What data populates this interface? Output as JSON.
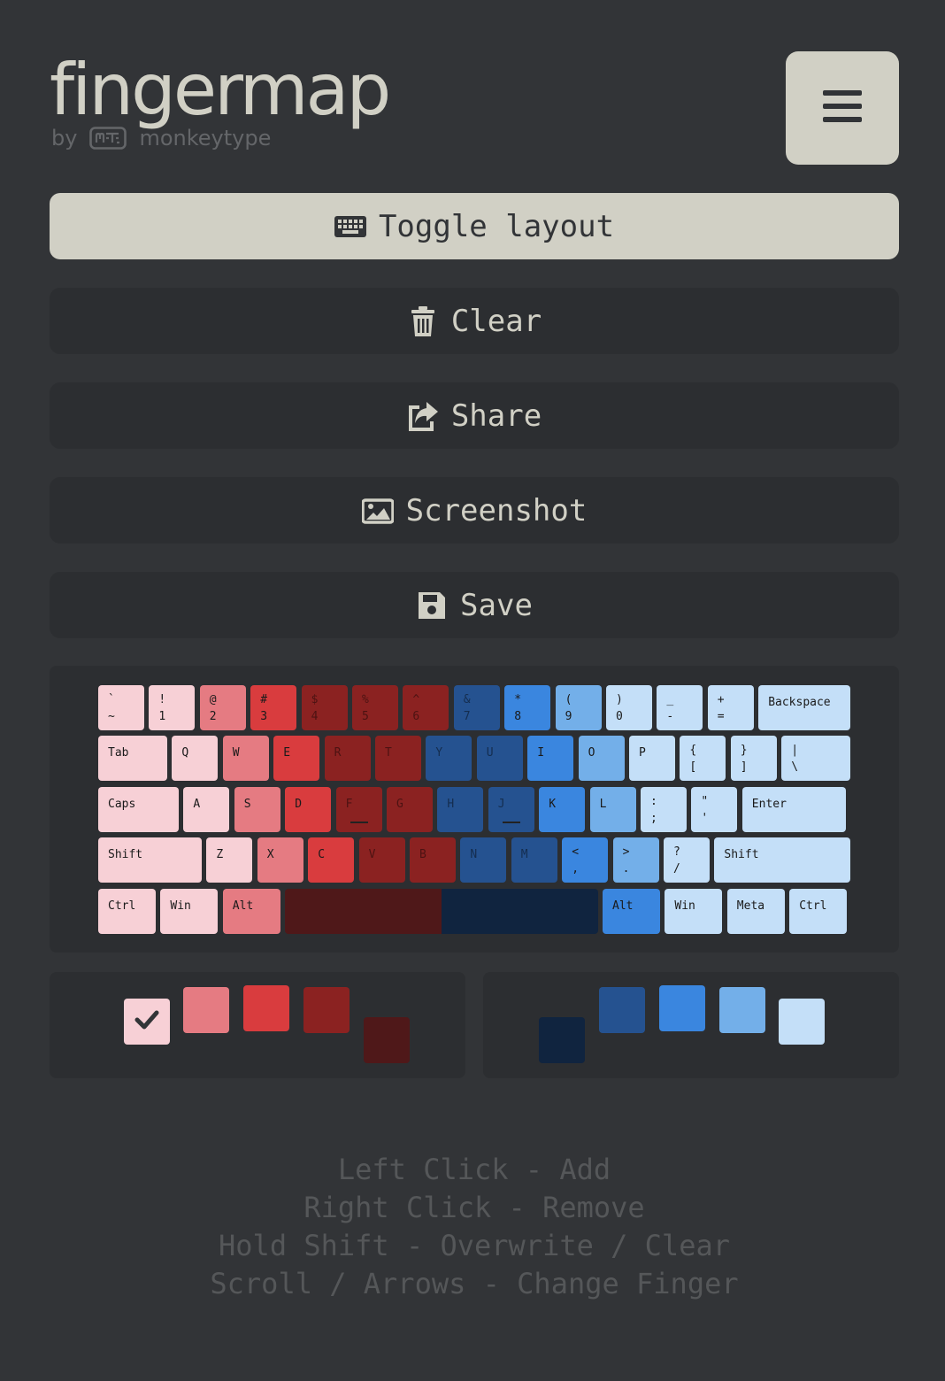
{
  "header": {
    "title": "fingermap",
    "by_label": "by",
    "brand_icon": "monkeytype-logo-icon",
    "brand_name": "monkeytype",
    "menu_icon": "hamburger-menu-icon"
  },
  "actions": [
    {
      "label": "Toggle layout",
      "icon": "keyboard-icon",
      "primary": true
    },
    {
      "label": "Clear",
      "icon": "trash-icon",
      "primary": false
    },
    {
      "label": "Share",
      "icon": "share-icon",
      "primary": false
    },
    {
      "label": "Screenshot",
      "icon": "image-icon",
      "primary": false
    },
    {
      "label": "Save",
      "icon": "floppy-disk-icon",
      "primary": false
    }
  ],
  "colors": {
    "background": "#323437",
    "panel": "#2c2e31",
    "text": "#d1d0c5",
    "muted": "#555759",
    "left_fingers": [
      "#f7d0d6",
      "#e57b82",
      "#d93c3e",
      "#8b2221",
      "#4f1819"
    ],
    "right_fingers": [
      "#10243f",
      "#255290",
      "#3a86df",
      "#73afe9",
      "#c4dff8"
    ]
  },
  "keyboard": {
    "rows": [
      [
        {
          "top": "`",
          "bottom": "~",
          "finger": "L0"
        },
        {
          "top": "!",
          "bottom": "1",
          "finger": "L0"
        },
        {
          "top": "@",
          "bottom": "2",
          "finger": "L1"
        },
        {
          "top": "#",
          "bottom": "3",
          "finger": "L2"
        },
        {
          "top": "$",
          "bottom": "4",
          "finger": "L3"
        },
        {
          "top": "%",
          "bottom": "5",
          "finger": "L3"
        },
        {
          "top": "^",
          "bottom": "6",
          "finger": "L3"
        },
        {
          "top": "&",
          "bottom": "7",
          "finger": "R1"
        },
        {
          "top": "*",
          "bottom": "8",
          "finger": "R2"
        },
        {
          "top": "(",
          "bottom": "9",
          "finger": "R3"
        },
        {
          "top": ")",
          "bottom": "0",
          "finger": "R4"
        },
        {
          "top": "_",
          "bottom": "-",
          "finger": "R4"
        },
        {
          "top": "+",
          "bottom": "=",
          "finger": "R4"
        },
        {
          "label": "Backspace",
          "finger": "R4"
        }
      ],
      [
        {
          "label": "Tab",
          "finger": "L0"
        },
        {
          "label": "Q",
          "finger": "L0"
        },
        {
          "label": "W",
          "finger": "L1"
        },
        {
          "label": "E",
          "finger": "L2"
        },
        {
          "label": "R",
          "finger": "L3"
        },
        {
          "label": "T",
          "finger": "L3"
        },
        {
          "label": "Y",
          "finger": "R1"
        },
        {
          "label": "U",
          "finger": "R1"
        },
        {
          "label": "I",
          "finger": "R2"
        },
        {
          "label": "O",
          "finger": "R3"
        },
        {
          "label": "P",
          "finger": "R4"
        },
        {
          "top": "{",
          "bottom": "[",
          "finger": "R4"
        },
        {
          "top": "}",
          "bottom": "]",
          "finger": "R4"
        },
        {
          "top": "|",
          "bottom": "\\",
          "finger": "R4"
        }
      ],
      [
        {
          "label": "Caps",
          "finger": "L0"
        },
        {
          "label": "A",
          "finger": "L0"
        },
        {
          "label": "S",
          "finger": "L1"
        },
        {
          "label": "D",
          "finger": "L2"
        },
        {
          "label": "F",
          "finger": "L3",
          "bump": true
        },
        {
          "label": "G",
          "finger": "L3"
        },
        {
          "label": "H",
          "finger": "R1"
        },
        {
          "label": "J",
          "finger": "R1",
          "bump": true
        },
        {
          "label": "K",
          "finger": "R2"
        },
        {
          "label": "L",
          "finger": "R3"
        },
        {
          "top": ":",
          "bottom": ";",
          "finger": "R4"
        },
        {
          "top": "\"",
          "bottom": "'",
          "finger": "R4"
        },
        {
          "label": "Enter",
          "finger": "R4"
        }
      ],
      [
        {
          "label": "Shift",
          "finger": "L0"
        },
        {
          "label": "Z",
          "finger": "L0"
        },
        {
          "label": "X",
          "finger": "L1"
        },
        {
          "label": "C",
          "finger": "L2"
        },
        {
          "label": "V",
          "finger": "L3"
        },
        {
          "label": "B",
          "finger": "L3"
        },
        {
          "label": "N",
          "finger": "R1"
        },
        {
          "label": "M",
          "finger": "R1"
        },
        {
          "top": "<",
          "bottom": ",",
          "finger": "R2"
        },
        {
          "top": ">",
          "bottom": ".",
          "finger": "R3"
        },
        {
          "top": "?",
          "bottom": "/",
          "finger": "R4"
        },
        {
          "label": "Shift",
          "finger": "R4"
        }
      ],
      [
        {
          "label": "Ctrl",
          "finger": "L0"
        },
        {
          "label": "Win",
          "finger": "L0"
        },
        {
          "label": "Alt",
          "finger": "L1"
        },
        {
          "label": "",
          "finger": "L4"
        },
        {
          "label": "",
          "finger": "R0"
        },
        {
          "label": "Alt",
          "finger": "R2"
        },
        {
          "label": "Win",
          "finger": "R4"
        },
        {
          "label": "Meta",
          "finger": "R4"
        },
        {
          "label": "Ctrl",
          "finger": "R4"
        }
      ]
    ]
  },
  "palette": {
    "selected": "L0",
    "selected_icon": "checkmark-icon"
  },
  "instructions": [
    "Left Click - Add",
    "Right Click - Remove",
    "Hold Shift - Overwrite / Clear",
    "Scroll / Arrows - Change Finger"
  ]
}
